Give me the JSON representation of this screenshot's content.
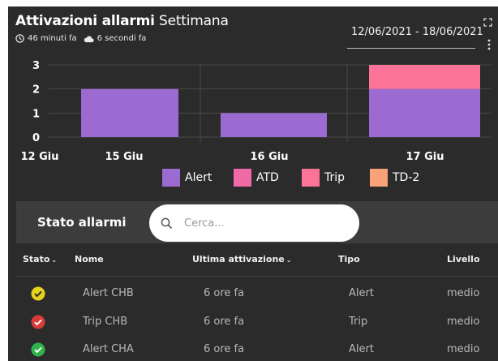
{
  "header": {
    "title_bold": "Attivazioni allarmi",
    "title_light": "Settimana",
    "updated_ago": "46 minuti fa",
    "synced_ago": "6 secondi fa",
    "date_range": "12/06/2021 - 18/06/2021"
  },
  "chart_data": {
    "type": "bar",
    "stacked": true,
    "y_ticks": [
      "0",
      "1",
      "2",
      "3"
    ],
    "ylim": [
      0,
      3
    ],
    "x_tick_labels": [
      "12 Giu",
      "15 Giu",
      "16 Giu",
      "17 Giu"
    ],
    "categories": [
      "15 Giu",
      "16 Giu",
      "17 Giu"
    ],
    "series": [
      {
        "name": "Alert",
        "values": [
          2,
          1,
          2
        ],
        "color": "#9b6bd1"
      },
      {
        "name": "ATD",
        "values": [
          0,
          0,
          0
        ],
        "color": "#f06aa8"
      },
      {
        "name": "Trip",
        "values": [
          0,
          0,
          1
        ],
        "color": "#fb7397"
      },
      {
        "name": "TD-2",
        "values": [
          0,
          0,
          0
        ],
        "color": "#f9a177"
      }
    ],
    "grid": true,
    "legend_position": "bottom"
  },
  "legend": [
    {
      "label": "Alert",
      "color": "#9b6bd1"
    },
    {
      "label": "ATD",
      "color": "#f06aa8"
    },
    {
      "label": "Trip",
      "color": "#fb7397"
    },
    {
      "label": "TD-2",
      "color": "#f9a177"
    }
  ],
  "table": {
    "title": "Stato allarmi",
    "search_placeholder": "Cerca...",
    "columns": [
      "Stato",
      "Nome",
      "Ultima attivazione",
      "Tipo",
      "Livello"
    ],
    "rows": [
      {
        "status": "yellow-check-icon",
        "status_color": "#e6d11d",
        "name": "Alert CHB",
        "last": "6 ore fa",
        "type": "Alert",
        "level": "medio"
      },
      {
        "status": "red-check-icon",
        "status_color": "#d83a3a",
        "name": "Trip CHB",
        "last": "6 ore fa",
        "type": "Trip",
        "level": "medio"
      },
      {
        "status": "green-check-icon",
        "status_color": "#2fb24b",
        "name": "Alert CHA",
        "last": "6 ore fa",
        "type": "Alert",
        "level": "medio"
      }
    ]
  }
}
